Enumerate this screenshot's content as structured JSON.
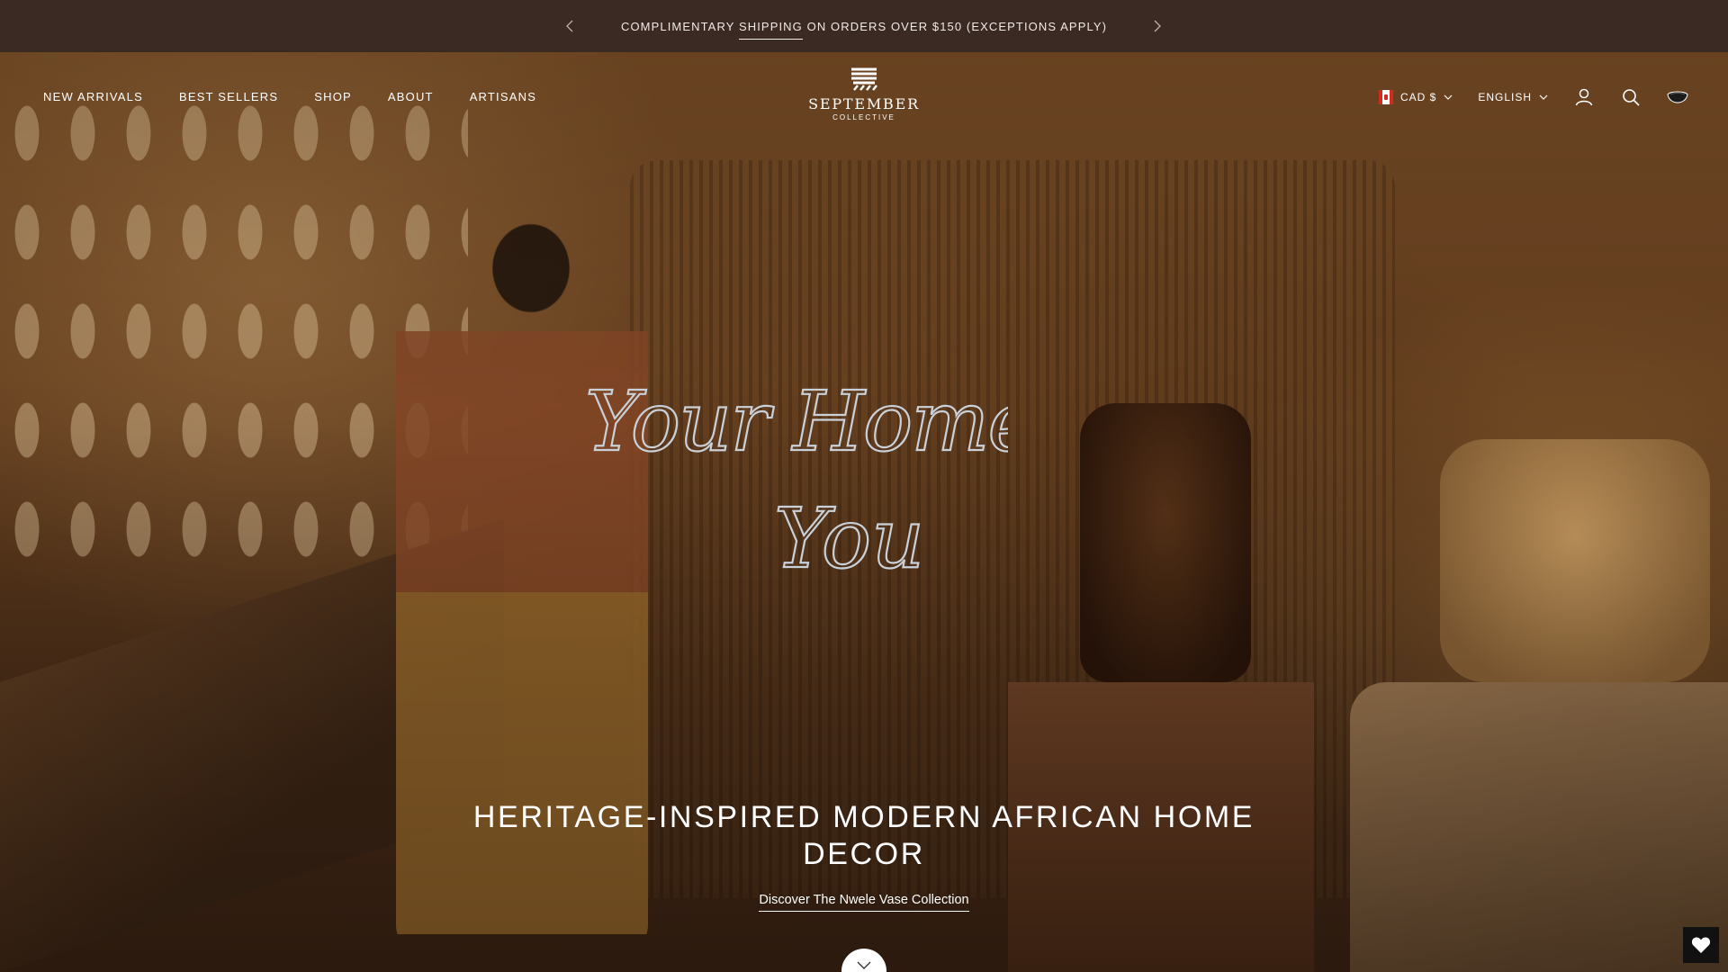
{
  "announcement": {
    "prefix": "Complimentary ",
    "link": "shipping",
    "suffix": " on orders over $150 (exceptions apply)",
    "prev_icon": "chevron-left-icon",
    "next_icon": "chevron-right-icon"
  },
  "nav": {
    "items": [
      {
        "label": "NEW ARRIVALS"
      },
      {
        "label": "BEST SELLERS"
      },
      {
        "label": "SHOP"
      },
      {
        "label": "ABOUT"
      },
      {
        "label": "ARTISANS"
      }
    ]
  },
  "logo": {
    "name": "SEPTEMBER",
    "sub": "COLLECTIVE"
  },
  "header_right": {
    "currency": "CAD $",
    "language": "ENGLISH",
    "icons": [
      "account-icon",
      "search-icon",
      "cart-icon"
    ]
  },
  "hero": {
    "script_line1": "Your Home.",
    "script_line2": "You",
    "headline": "HERITAGE-INSPIRED MODERN AFRICAN HOME DECOR",
    "cta": "Discover The Nwele Vase Collection",
    "scroll_icon": "chevron-down-icon"
  },
  "floating": {
    "wishlist_icon": "heart-icon"
  },
  "colors": {
    "announcement_bg": "#3b2a24",
    "text": "#ffffff"
  }
}
